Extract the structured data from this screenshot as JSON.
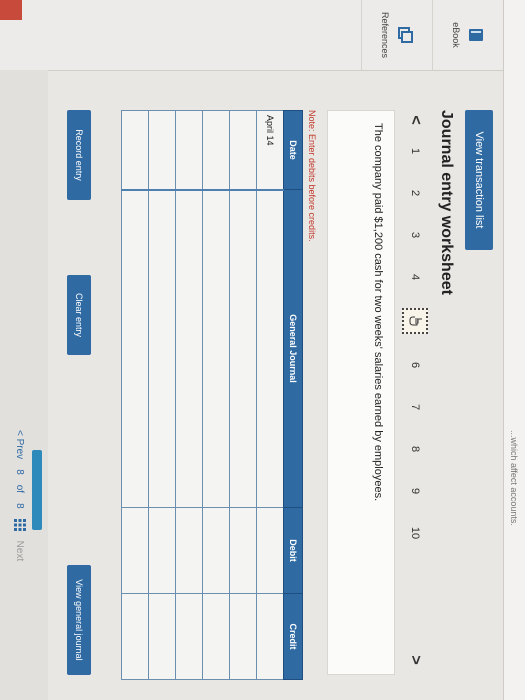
{
  "top_strip": {
    "text": "...which affect accounts."
  },
  "side": {
    "ebook_label": "eBook",
    "references_label": "References"
  },
  "header": {
    "view_transactions": "View transaction list",
    "title": "Journal entry worksheet"
  },
  "pager": {
    "prev_arrow": "<",
    "next_arrow": ">",
    "pages": [
      "1",
      "2",
      "3",
      "4",
      "5",
      "6",
      "7",
      "8",
      "9",
      "10"
    ],
    "active_page": "5"
  },
  "description": "The company paid $1,200 cash for two weeks' salaries earned by employees.",
  "note": "Note: Enter debits before credits.",
  "journal": {
    "headers": {
      "date": "Date",
      "general_journal": "General Journal",
      "debit": "Debit",
      "credit": "Credit"
    },
    "rows": [
      {
        "date": "April 14",
        "account": "",
        "debit": "",
        "credit": ""
      },
      {
        "date": "",
        "account": "",
        "debit": "",
        "credit": ""
      },
      {
        "date": "",
        "account": "",
        "debit": "",
        "credit": ""
      },
      {
        "date": "",
        "account": "",
        "debit": "",
        "credit": ""
      },
      {
        "date": "",
        "account": "",
        "debit": "",
        "credit": ""
      },
      {
        "date": "",
        "account": "",
        "debit": "",
        "credit": ""
      }
    ]
  },
  "buttons": {
    "record_entry": "Record entry",
    "clear_entry": "Clear entry",
    "view_general_journal": "View general journal"
  },
  "footer": {
    "prev": "< Prev",
    "position": "8",
    "of_label": "of",
    "total": "8",
    "next": "Next"
  },
  "colors": {
    "accent": "#2f6aa3",
    "note_red": "#c0392b"
  }
}
